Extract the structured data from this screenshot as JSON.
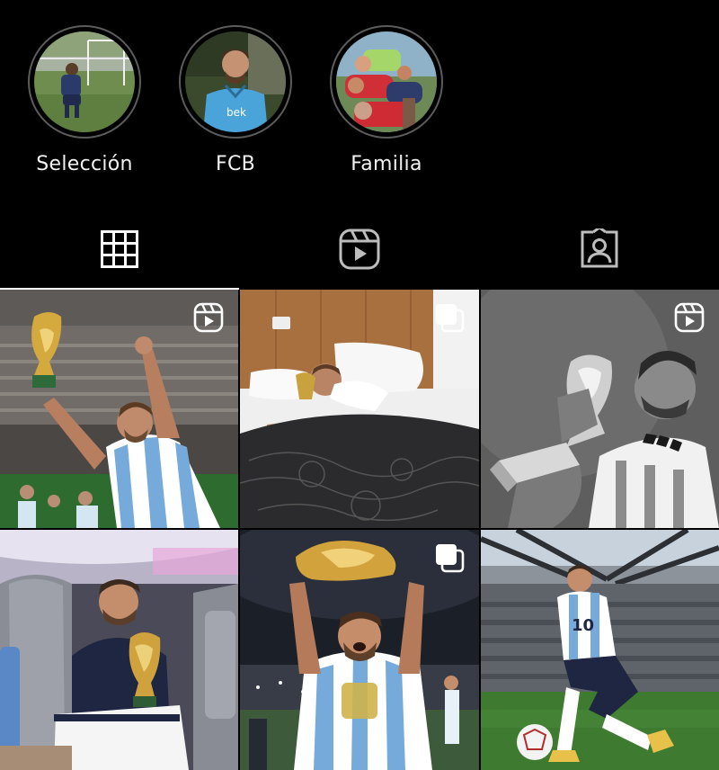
{
  "highlights": [
    {
      "label": "Selección",
      "icon": "highlight-photo-coach-field"
    },
    {
      "label": "FCB",
      "icon": "highlight-photo-barca-shirt"
    },
    {
      "label": "Familia",
      "icon": "highlight-photo-family"
    }
  ],
  "tabs": [
    {
      "name": "posts",
      "icon": "grid-icon",
      "active": true
    },
    {
      "name": "reels",
      "icon": "reels-icon",
      "active": false
    },
    {
      "name": "tagged",
      "icon": "tagged-person-icon",
      "active": false
    }
  ],
  "posts": [
    {
      "type": "reel",
      "badge_icon": "reels-icon",
      "scene": "trophy-celebration-stadium"
    },
    {
      "type": "carousel",
      "badge_icon": "carousel-icon",
      "scene": "sleeping-with-trophy"
    },
    {
      "type": "reel",
      "badge_icon": "reels-icon",
      "scene": "kissing-trophy-bw"
    },
    {
      "type": "photo",
      "badge_icon": null,
      "scene": "trophy-on-plane"
    },
    {
      "type": "carousel",
      "badge_icon": "carousel-icon",
      "scene": "lifting-trophy-night"
    },
    {
      "type": "photo",
      "badge_icon": null,
      "scene": "kneeling-with-ball-stadium"
    }
  ],
  "colors": {
    "background": "#000000",
    "text": "#ffffff",
    "ring": "#5c5c5c",
    "argentina_blue": "#75aadb"
  }
}
